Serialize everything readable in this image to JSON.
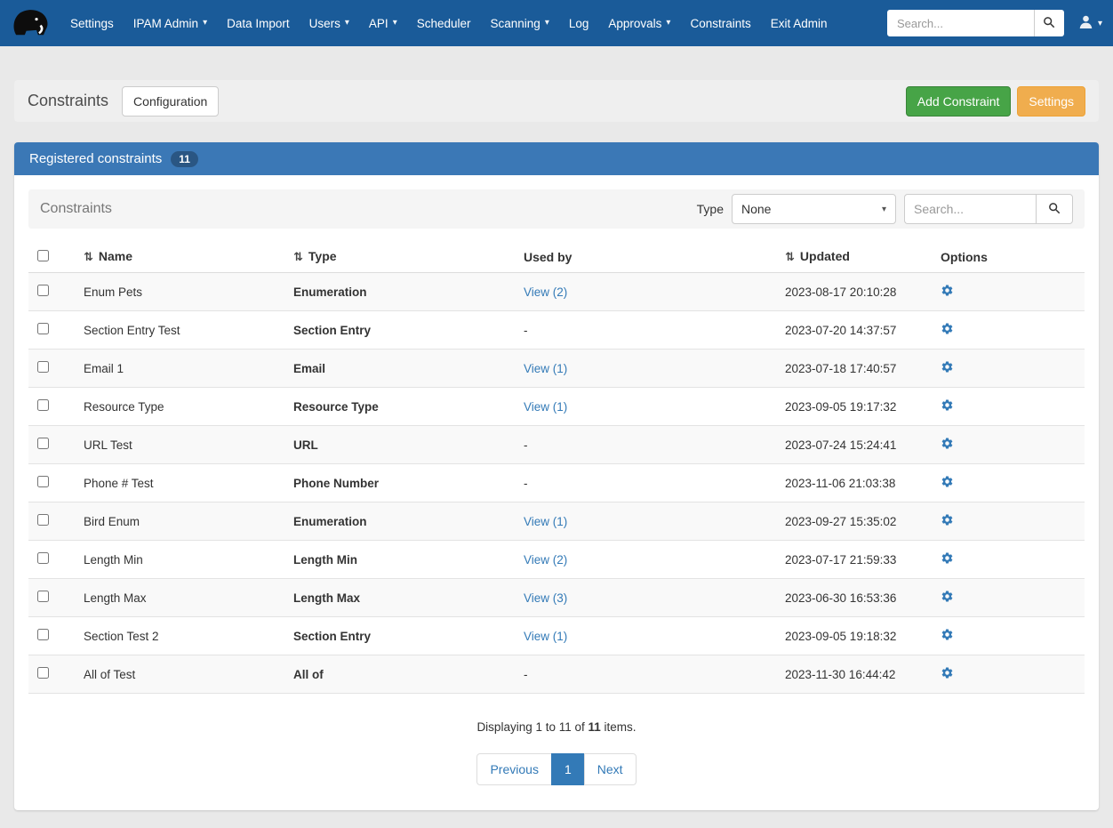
{
  "colors": {
    "navbar_bg": "#1a5b99",
    "panel_header_bg": "#3b78b6",
    "link_blue": "#337ab7",
    "success_green": "#47a447",
    "warning_orange": "#f0ad4e"
  },
  "icons": {
    "sort": "⇅",
    "caret_down": "▾"
  },
  "navbar": {
    "search_placeholder": "Search...",
    "items": [
      {
        "label": "Settings",
        "dropdown": false
      },
      {
        "label": "IPAM Admin",
        "dropdown": true
      },
      {
        "label": "Data Import",
        "dropdown": false
      },
      {
        "label": "Users",
        "dropdown": true
      },
      {
        "label": "API",
        "dropdown": true
      },
      {
        "label": "Scheduler",
        "dropdown": false
      },
      {
        "label": "Scanning",
        "dropdown": true
      },
      {
        "label": "Log",
        "dropdown": false
      },
      {
        "label": "Approvals",
        "dropdown": true
      },
      {
        "label": "Constraints",
        "dropdown": false
      },
      {
        "label": "Exit Admin",
        "dropdown": false
      }
    ]
  },
  "page_header": {
    "title": "Constraints",
    "configuration_button": "Configuration",
    "add_constraint_button": "Add Constraint",
    "settings_button": "Settings"
  },
  "panel": {
    "title": "Registered constraints",
    "count_badge": "11",
    "toolbar": {
      "title": "Constraints",
      "type_label": "Type",
      "type_value": "None",
      "search_placeholder": "Search..."
    },
    "table": {
      "headers": {
        "name": "Name",
        "type": "Type",
        "used_by": "Used by",
        "updated": "Updated",
        "options": "Options"
      },
      "rows": [
        {
          "name": "Enum Pets",
          "type": "Enumeration",
          "used_by": "View (2)",
          "used_by_link": true,
          "updated": "2023-08-17 20:10:28"
        },
        {
          "name": "Section Entry Test",
          "type": "Section Entry",
          "used_by": "-",
          "used_by_link": false,
          "updated": "2023-07-20 14:37:57"
        },
        {
          "name": "Email 1",
          "type": "Email",
          "used_by": "View (1)",
          "used_by_link": true,
          "updated": "2023-07-18 17:40:57"
        },
        {
          "name": "Resource Type",
          "type": "Resource Type",
          "used_by": "View (1)",
          "used_by_link": true,
          "updated": "2023-09-05 19:17:32"
        },
        {
          "name": "URL Test",
          "type": "URL",
          "used_by": "-",
          "used_by_link": false,
          "updated": "2023-07-24 15:24:41"
        },
        {
          "name": "Phone # Test",
          "type": "Phone Number",
          "used_by": "-",
          "used_by_link": false,
          "updated": "2023-11-06 21:03:38"
        },
        {
          "name": "Bird Enum",
          "type": "Enumeration",
          "used_by": "View (1)",
          "used_by_link": true,
          "updated": "2023-09-27 15:35:02"
        },
        {
          "name": "Length Min",
          "type": "Length Min",
          "used_by": "View (2)",
          "used_by_link": true,
          "updated": "2023-07-17 21:59:33"
        },
        {
          "name": "Length Max",
          "type": "Length Max",
          "used_by": "View (3)",
          "used_by_link": true,
          "updated": "2023-06-30 16:53:36"
        },
        {
          "name": "Section Test 2",
          "type": "Section Entry",
          "used_by": "View (1)",
          "used_by_link": true,
          "updated": "2023-09-05 19:18:32"
        },
        {
          "name": "All of Test",
          "type": "All of",
          "used_by": "-",
          "used_by_link": false,
          "updated": "2023-11-30 16:44:42"
        }
      ]
    },
    "footer": {
      "summary_prefix": "Displaying 1 to 11 of ",
      "summary_count": "11",
      "summary_suffix": " items.",
      "pagination": {
        "previous": "Previous",
        "page": "1",
        "next": "Next"
      }
    }
  }
}
